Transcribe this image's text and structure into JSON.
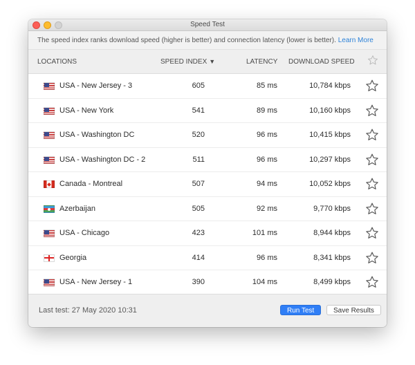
{
  "window": {
    "title": "Speed Test"
  },
  "info": {
    "text": "The speed index ranks download speed (higher is better) and connection latency (lower is better).",
    "link": "Learn More"
  },
  "header": {
    "locations": "LOCATIONS",
    "speed_index": "SPEED INDEX",
    "sort_arrow": "▼",
    "latency": "LATENCY",
    "download_speed": "DOWNLOAD SPEED",
    "star": "☆"
  },
  "rows": [
    {
      "flag": "us",
      "name": "USA - New Jersey - 3",
      "speed": "605",
      "latency": "85 ms",
      "download": "10,784 kbps",
      "star": "☆"
    },
    {
      "flag": "us",
      "name": "USA - New York",
      "speed": "541",
      "latency": "89 ms",
      "download": "10,160 kbps",
      "star": "☆"
    },
    {
      "flag": "us",
      "name": "USA - Washington DC",
      "speed": "520",
      "latency": "96 ms",
      "download": "10,415 kbps",
      "star": "☆"
    },
    {
      "flag": "us",
      "name": "USA - Washington DC - 2",
      "speed": "511",
      "latency": "96 ms",
      "download": "10,297 kbps",
      "star": "☆"
    },
    {
      "flag": "ca",
      "name": "Canada - Montreal",
      "speed": "507",
      "latency": "94 ms",
      "download": "10,052 kbps",
      "star": "☆"
    },
    {
      "flag": "az",
      "name": "Azerbaijan",
      "speed": "505",
      "latency": "92 ms",
      "download": "9,770 kbps",
      "star": "☆"
    },
    {
      "flag": "us",
      "name": "USA - Chicago",
      "speed": "423",
      "latency": "101 ms",
      "download": "8,944 kbps",
      "star": "☆"
    },
    {
      "flag": "ge",
      "name": "Georgia",
      "speed": "414",
      "latency": "96 ms",
      "download": "8,341 kbps",
      "star": "☆"
    },
    {
      "flag": "us",
      "name": "USA - New Jersey - 1",
      "speed": "390",
      "latency": "104 ms",
      "download": "8,499 kbps",
      "star": "☆"
    }
  ],
  "footer": {
    "last_test": "Last test: 27 May 2020 10:31",
    "run_test": "Run Test",
    "save_results": "Save Results"
  },
  "colors": {
    "accent": "#2f7ef6",
    "link": "#2d82d8"
  }
}
